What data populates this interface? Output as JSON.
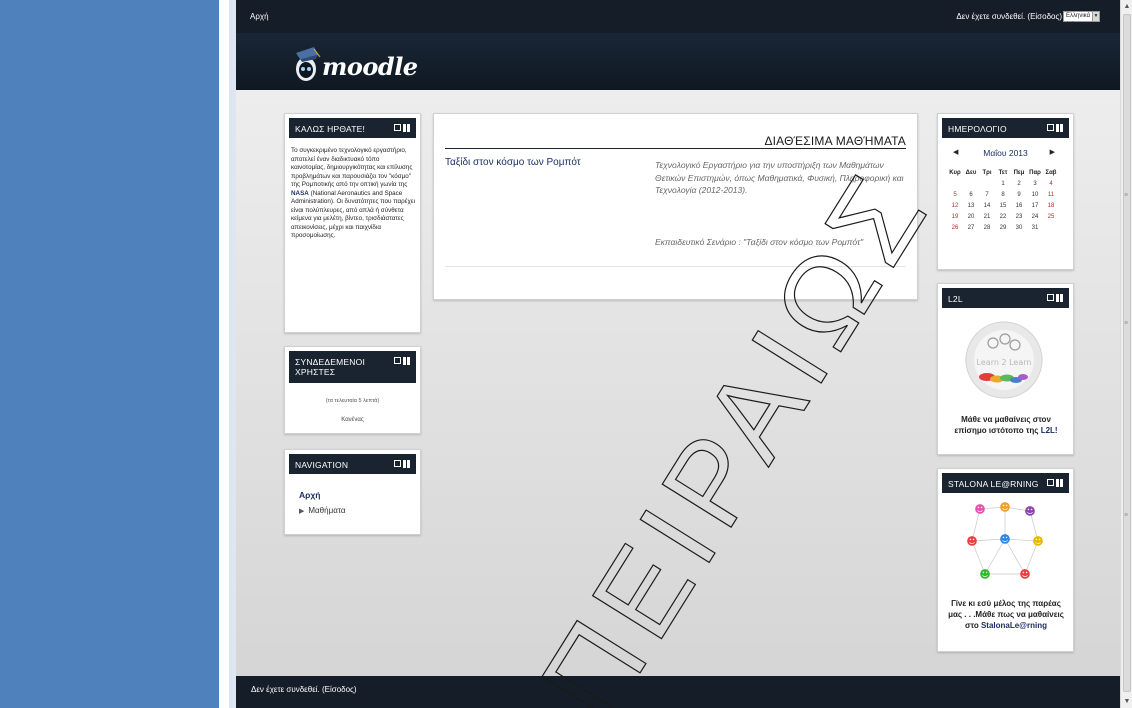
{
  "topbar": {
    "breadcrumb": "Αρχή",
    "login_info": "Δεν έχετε συνδεθεί. (Είσοδος)",
    "language": "Ελληνικά (el)"
  },
  "header": {
    "logo_text": "moodle"
  },
  "blocks": {
    "welcome": {
      "title": "ΚΑΛΩΣ ΗΡΘΑΤΕ!",
      "text_before": "Το συγκεκριμένο τεχνολογικό εργαστήριο, αποτελεί έναν διαδικτυακό τόπο καινοτομίας, δημιουργικότητας και επίλυσης προβλημάτων και παρουσιάζει τον \"κόσμο\" της Ρομποτικής από την οπτική γωνία της ",
      "text_bold": "NASA",
      "text_after": " (National Aeronautics and Space Administration). Οι δυνατότητες που παρέχει είναι πολύπλευρες, από απλά ή σύνθετα κείμενα για μελέτη, βίντεο, τρισδιάστατες απεικονίσεις, μέχρι και παιχνίδια προσομοίωσης."
    },
    "online_users": {
      "title": "ΣΥΝΔΕΔΕΜΕΝΟΙ ΧΡΗΣΤΕΣ",
      "subtitle": "(τα τελευταία 5 λεπτά)",
      "none": "Κανένας"
    },
    "navigation": {
      "title": "NAVIGATION",
      "home": "Αρχή",
      "courses": "Μαθήματα"
    },
    "calendar": {
      "title": "ΗΜΕΡΟΛΟΓΙΟ",
      "month": "Μαΐου 2013",
      "day_names": [
        "Κυρ",
        "Δευ",
        "Τρι",
        "Τετ",
        "Πεμ",
        "Παρ",
        "Σαβ"
      ],
      "weeks": [
        [
          "",
          "",
          "",
          "1",
          "2",
          "3",
          "4"
        ],
        [
          "5",
          "6",
          "7",
          "8",
          "9",
          "10",
          "11"
        ],
        [
          "12",
          "13",
          "14",
          "15",
          "16",
          "17",
          "18"
        ],
        [
          "19",
          "20",
          "21",
          "22",
          "23",
          "24",
          "25"
        ],
        [
          "26",
          "27",
          "28",
          "29",
          "30",
          "31",
          ""
        ]
      ]
    },
    "l2l": {
      "title": "L2L",
      "logo_text": "Learn 2 Learn",
      "caption_before": "Μάθε να μαθαίνεις στον επίσημο ιστότοπο της ",
      "caption_link": "L2L!"
    },
    "stalona": {
      "title": "STALONA LE@RNING",
      "caption_before": "Γίνε κι εσύ μέλος της παρέας μας . . .Μάθε πως να μαθαίνεις στο ",
      "caption_link": "StalonaLe@rning"
    }
  },
  "main": {
    "title": "ΔΙΑΘΈΣΙΜΑ ΜΑΘΉΜΑΤΑ",
    "course_name": "Ταξίδι στον κόσμο των Ρομπότ",
    "course_description": "Τεχνολογικό Εργαστήριο για την υποστήριξη των Μαθημάτων Θετικών Επιστημών, όπως Μαθηματικά, Φυσική, Πληροφορική και Τεχνολογία (2012-2013).",
    "course_scenario": "Εκπαιδευτικό Σενάριο : \"Ταξίδι στον κόσμο των Ρομπότ\""
  },
  "footer": {
    "login_info": "Δεν έχετε συνδεθεί. (Είσοδος)"
  },
  "watermark": "ΠΕΙΡΑΙΩΣ",
  "colors": {
    "sidebar_blue": "#4f81bd",
    "dark_navy": "#141d28",
    "link_blue": "#1b2f63",
    "weekend_red": "#b02b2b"
  }
}
